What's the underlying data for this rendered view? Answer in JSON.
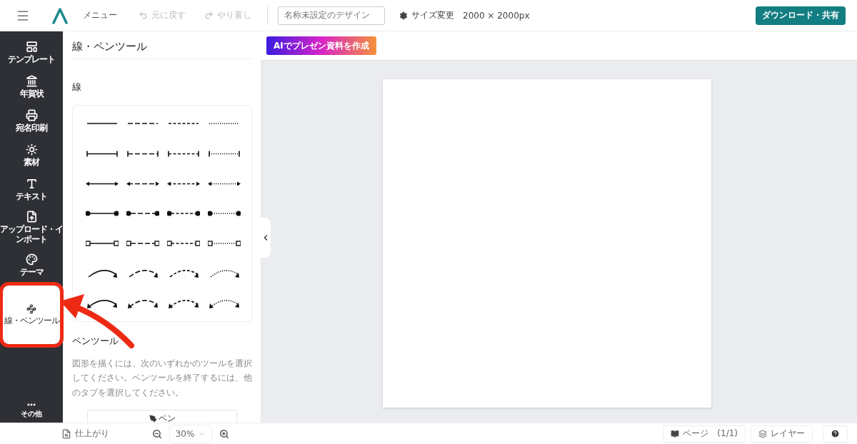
{
  "top_bar": {
    "menu_label": "メニュー",
    "undo": {
      "label": "元に戻す",
      "disabled": true
    },
    "redo": {
      "label": "やり直し",
      "disabled": true
    },
    "design_name": "名称未設定のデザイン",
    "resize_label": "サイズ変更",
    "size": "2000 × 2000px",
    "download_button": "ダウンロード・共有"
  },
  "sidebar": {
    "items": [
      {
        "kind": "template",
        "label": "テンプレート",
        "selected": false
      },
      {
        "kind": "newyear",
        "label": "年賀状",
        "selected": false
      },
      {
        "kind": "print",
        "label": "宛名印刷",
        "selected": false
      },
      {
        "kind": "material",
        "label": "素材",
        "selected": false
      },
      {
        "kind": "text",
        "label": "テキスト",
        "selected": false
      },
      {
        "kind": "upload",
        "label": "アップロード・インポート",
        "selected": false
      },
      {
        "kind": "theme",
        "label": "テーマ",
        "selected": false
      },
      {
        "kind": "line",
        "label": "線・ペンツール",
        "selected": true
      }
    ],
    "more": {
      "label": "その他"
    }
  },
  "panel": {
    "title": "線・ペンツール",
    "lines_heading": "線",
    "line_rows": [
      {
        "kind": "plain"
      },
      {
        "kind": "bar-ends"
      },
      {
        "kind": "arrows"
      },
      {
        "kind": "dots"
      },
      {
        "kind": "squares"
      },
      {
        "kind": "curve-arrow"
      },
      {
        "kind": "curve-double-arrow"
      }
    ],
    "dash_styles": [
      {
        "kind": "solid"
      },
      {
        "kind": "long-dash"
      },
      {
        "kind": "short-dash"
      },
      {
        "kind": "dotted"
      }
    ],
    "pen_heading": "ペンツール",
    "pen_description": "図形を描くには、次のいずれかのツールを選択してください。ペンツールを終了するには、他のタブを選択してください。",
    "pen_button": "ペン"
  },
  "canvas": {
    "ai_button": "AIでプレゼン資料を作成"
  },
  "bottom_bar": {
    "finish_label": "仕上がり",
    "zoom": "30%",
    "page_button": "ページ　(1/1)",
    "layer_button": "レイヤー"
  }
}
